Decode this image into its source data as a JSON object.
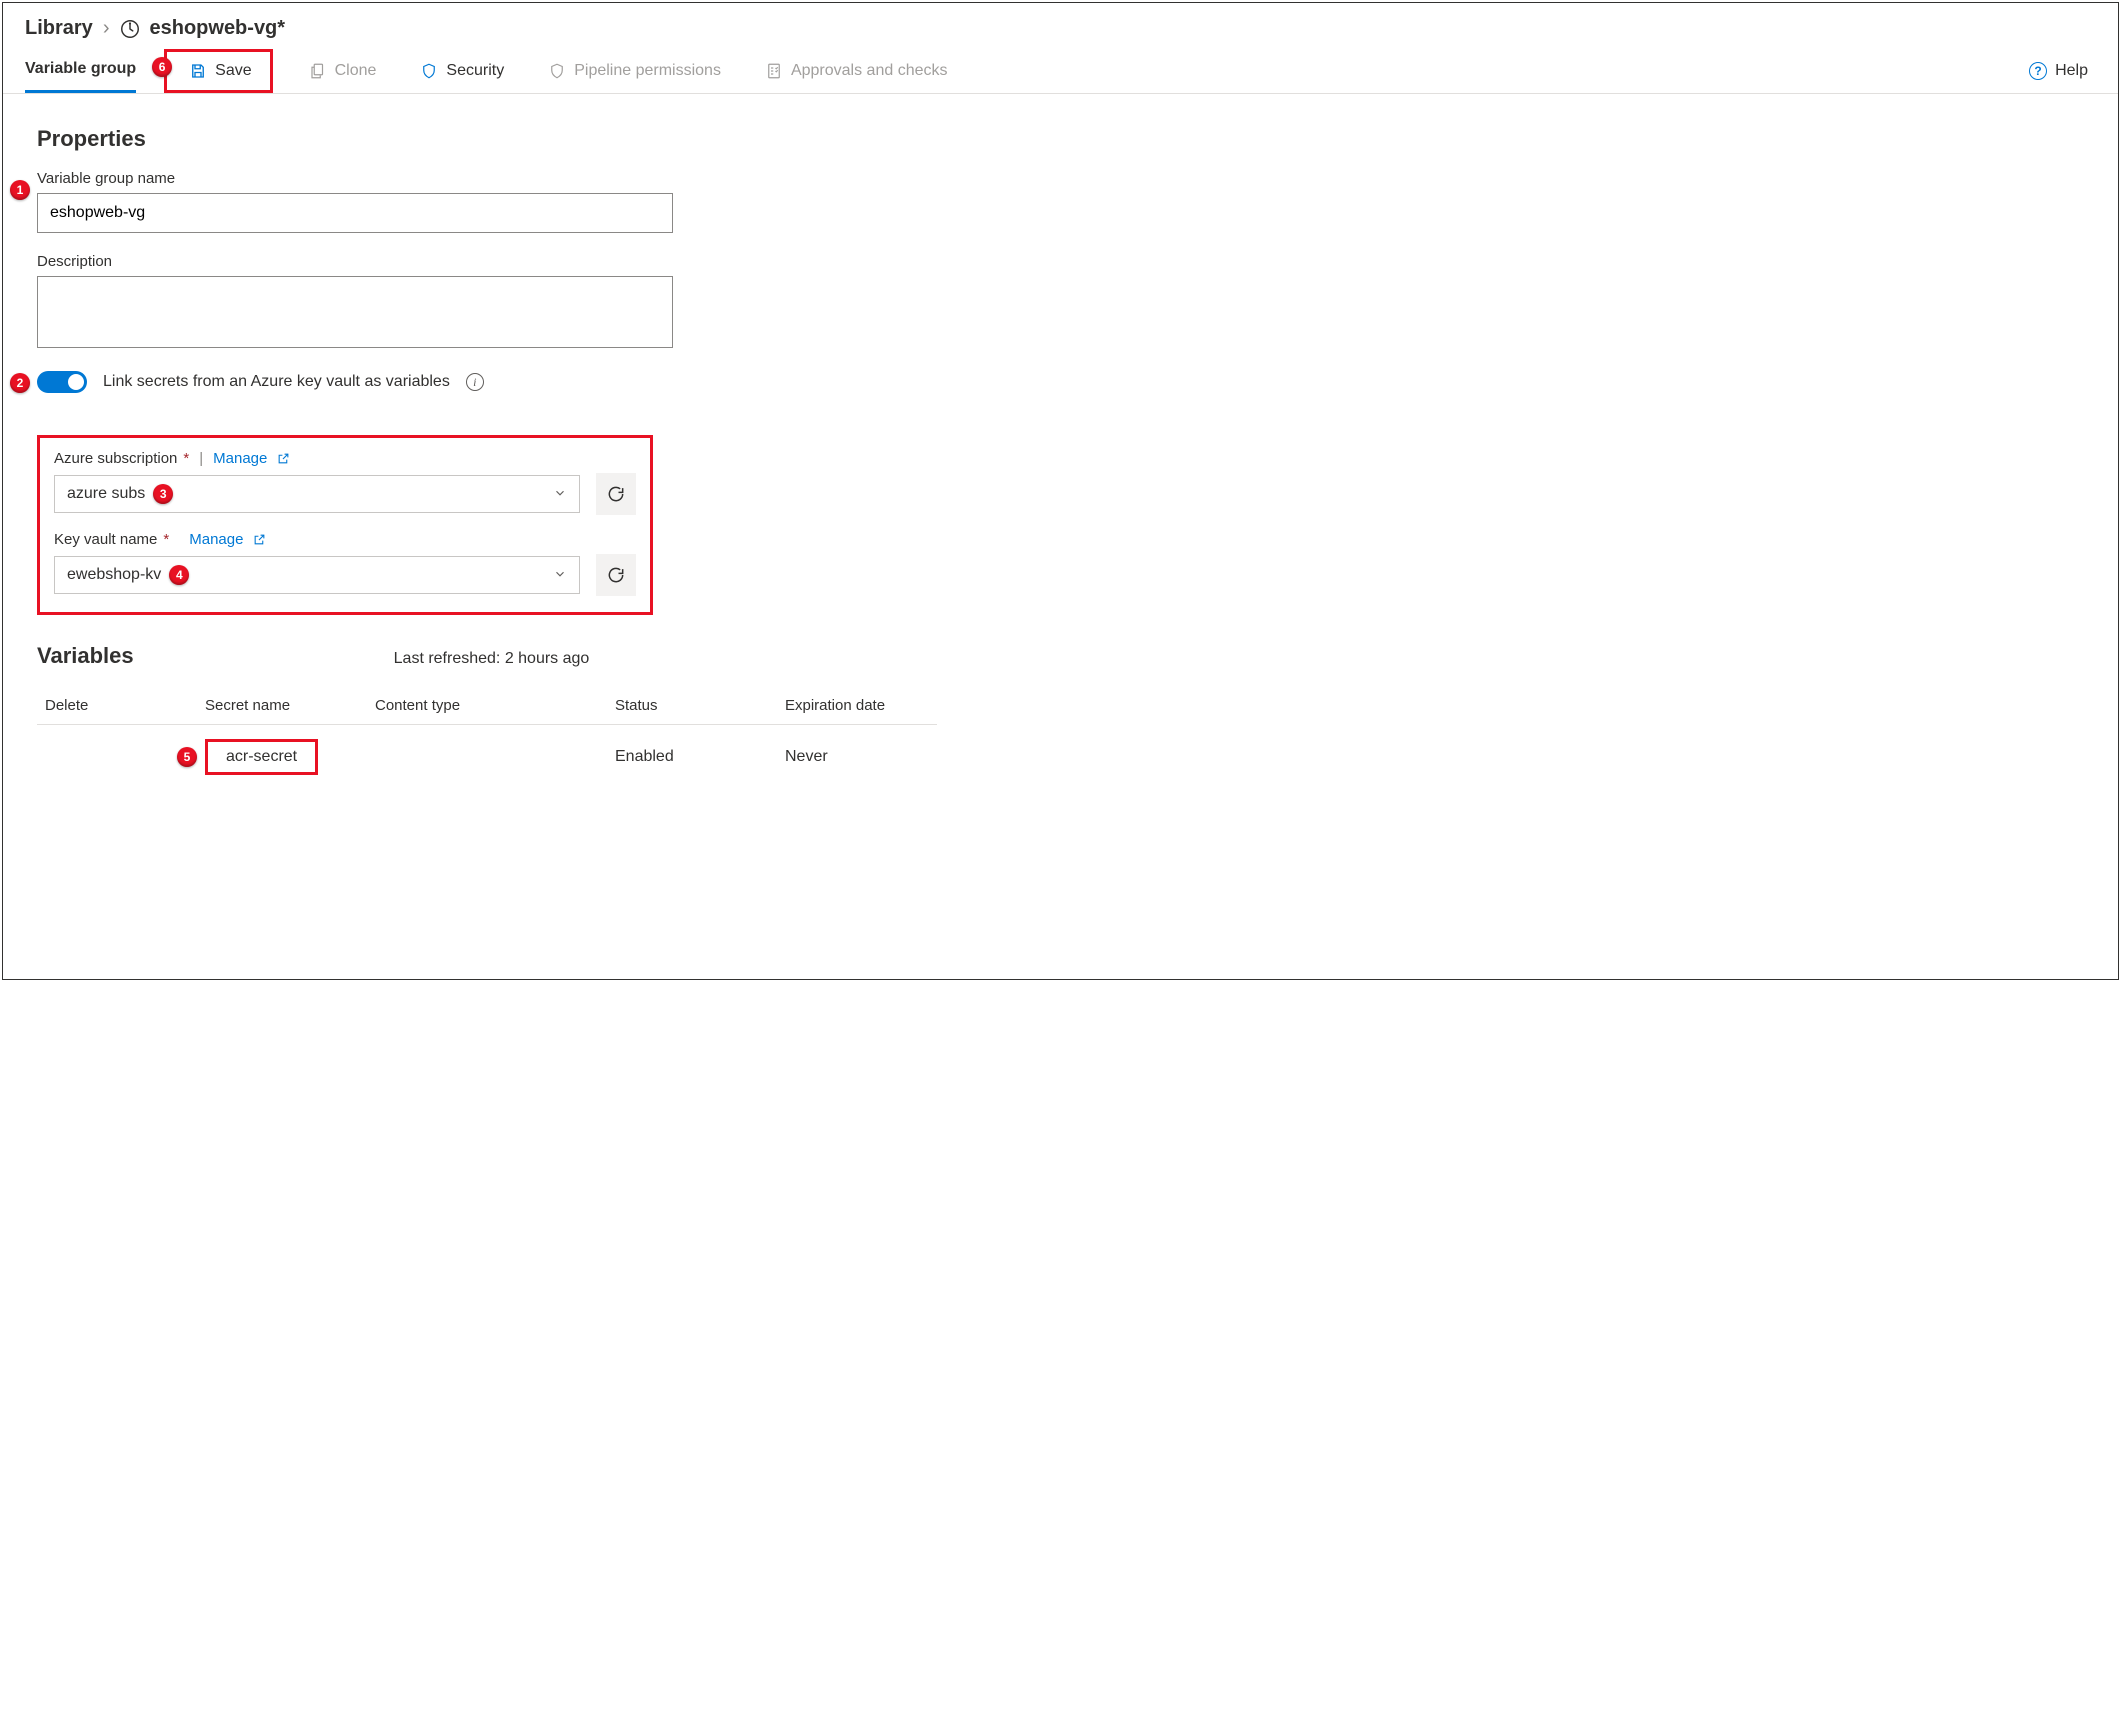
{
  "breadcrumb": {
    "root": "Library",
    "current": "eshopweb-vg*"
  },
  "toolbar": {
    "tab": "Variable group",
    "save": "Save",
    "clone": "Clone",
    "security": "Security",
    "pipeline": "Pipeline permissions",
    "approvals": "Approvals and checks",
    "help": "Help"
  },
  "callouts": {
    "c1": "1",
    "c2": "2",
    "c3": "3",
    "c4": "4",
    "c5": "5",
    "c6": "6"
  },
  "properties": {
    "heading": "Properties",
    "name_label": "Variable group name",
    "name_value": "eshopweb-vg",
    "desc_label": "Description",
    "desc_value": "",
    "toggle_label": "Link secrets from an Azure key vault as variables"
  },
  "kv": {
    "sub_label": "Azure subscription",
    "manage": "Manage",
    "sub_value": "azure subs",
    "vault_label": "Key vault name",
    "vault_value": "ewebshop-kv"
  },
  "variables": {
    "heading": "Variables",
    "last_refreshed": "Last refreshed: 2 hours ago",
    "cols": {
      "delete": "Delete",
      "secret": "Secret name",
      "content": "Content type",
      "status": "Status",
      "exp": "Expiration date"
    },
    "rows": [
      {
        "secret": "acr-secret",
        "content": "",
        "status": "Enabled",
        "exp": "Never"
      }
    ]
  }
}
